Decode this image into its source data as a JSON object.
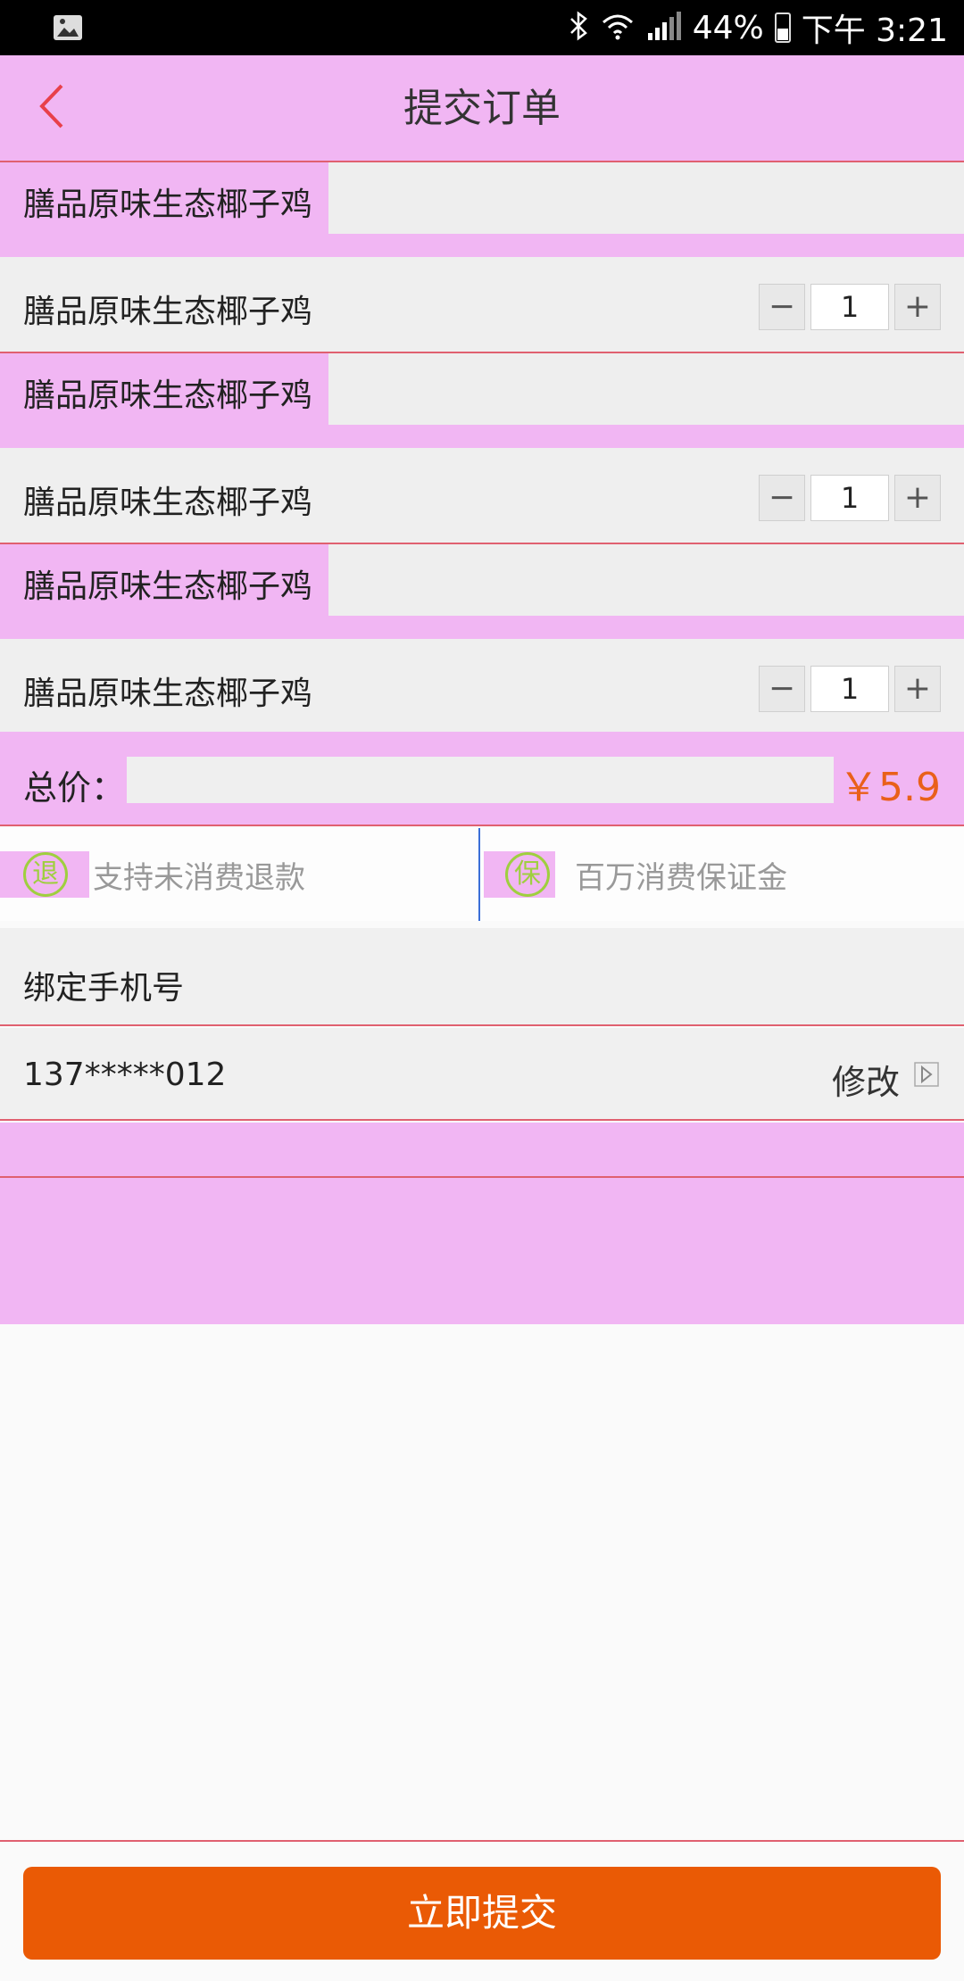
{
  "status_bar": {
    "battery": "44%",
    "time": "下午 3:21",
    "icons": [
      "image-icon",
      "bluetooth-icon",
      "wifi-icon",
      "signal-icon",
      "battery-icon"
    ]
  },
  "header": {
    "title": "提交订单",
    "back_icon": "chevron-left-icon"
  },
  "orders": [
    {
      "title": "膳品原味生态椰子鸡",
      "item_name": "膳品原味生态椰子鸡",
      "minus": "−",
      "quantity": "1",
      "plus": "+"
    },
    {
      "title": "膳品原味生态椰子鸡",
      "item_name": "膳品原味生态椰子鸡",
      "minus": "−",
      "quantity": "1",
      "plus": "+"
    },
    {
      "title": "膳品原味生态椰子鸡",
      "item_name": "膳品原味生态椰子鸡",
      "minus": "−",
      "quantity": "1",
      "plus": "+"
    }
  ],
  "total": {
    "label": "总价：",
    "price": "￥5.9"
  },
  "guarantee": {
    "refund_badge": "退",
    "refund_text": "支持未消费退款",
    "insure_badge": "保",
    "insure_text": "百万消费保证金"
  },
  "phone": {
    "label": "绑定手机号",
    "number": "137*****012",
    "edit": "修改"
  },
  "submit": {
    "label": "立即提交"
  },
  "colors": {
    "accent": "#ea5a05",
    "price": "#e9601a",
    "badge": "#9fcf3f",
    "back_arrow": "#e8404a"
  }
}
